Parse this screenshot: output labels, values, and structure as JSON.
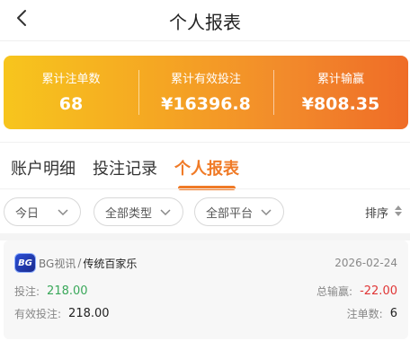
{
  "header": {
    "title": "个人报表"
  },
  "stats": [
    {
      "label": "累计注单数",
      "value": "68"
    },
    {
      "label": "累计有效投注",
      "value": "¥16396.8"
    },
    {
      "label": "累计输赢",
      "value": "¥808.35"
    }
  ],
  "tabs": [
    {
      "label": "账户明细"
    },
    {
      "label": "投注记录"
    },
    {
      "label": "个人报表",
      "active": true
    }
  ],
  "filters": {
    "date": "今日",
    "type": "全部类型",
    "platform": "全部平台",
    "sort": "排序"
  },
  "record": {
    "logo": "BG",
    "platform": "BG视讯",
    "separator": "/",
    "game": "传统百家乐",
    "date": "2026-02-24",
    "bet_label": "投注:",
    "bet_value": "218.00",
    "valid_bet_label": "有效投注:",
    "valid_bet_value": "218.00",
    "winloss_label": "总输赢:",
    "winloss_value": "-22.00",
    "count_label": "注单数:",
    "count_value": "6"
  },
  "colors": {
    "accent": "#f07a26",
    "positive": "#3aa85a",
    "negative": "#e03535"
  }
}
